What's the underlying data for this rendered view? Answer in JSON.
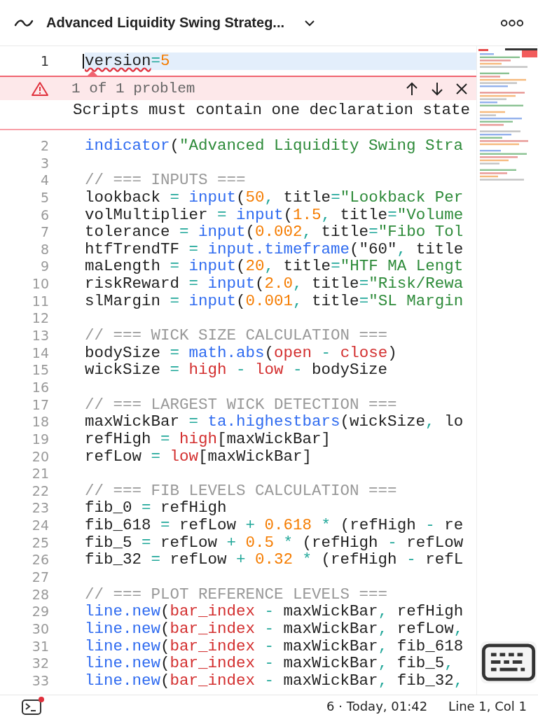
{
  "header": {
    "title": "Advanced Liquidity Swing Strateg..."
  },
  "lines": [
    {
      "number": "1",
      "current": true,
      "tokens": [
        {
          "text": "version",
          "kind": "plain",
          "error": true
        },
        {
          "text": "=",
          "kind": "op",
          "error": false
        },
        {
          "text": "5",
          "kind": "num",
          "error": false
        }
      ]
    },
    {
      "number": "2",
      "current": false,
      "tokens": [
        {
          "text": "indicator",
          "kind": "kw",
          "error": false
        },
        {
          "text": "(",
          "kind": "plain",
          "error": false
        },
        {
          "text": "\"Advanced Liquidity Swing Stra",
          "kind": "str",
          "error": false
        }
      ]
    },
    {
      "number": "3",
      "current": false
    },
    {
      "number": "4",
      "current": false,
      "tokens": [
        {
          "text": "// === INPUTS ===",
          "kind": "comment",
          "error": false
        }
      ]
    },
    {
      "number": "5",
      "current": false,
      "tokens": [
        {
          "text": "lookback ",
          "kind": "plain",
          "error": false
        },
        {
          "text": "= ",
          "kind": "op",
          "error": false
        },
        {
          "text": "input",
          "kind": "kw",
          "error": false
        },
        {
          "text": "(",
          "kind": "plain",
          "error": false
        },
        {
          "text": "50",
          "kind": "num",
          "error": false
        },
        {
          "text": ",",
          "kind": "op",
          "error": false
        },
        {
          "text": " title",
          "kind": "plain",
          "error": false
        },
        {
          "text": "=",
          "kind": "op",
          "error": false
        },
        {
          "text": "\"Lookback Per",
          "kind": "str",
          "error": false
        }
      ]
    },
    {
      "number": "6",
      "current": false,
      "tokens": [
        {
          "text": "volMultiplier ",
          "kind": "plain",
          "error": false
        },
        {
          "text": "= ",
          "kind": "op",
          "error": false
        },
        {
          "text": "input",
          "kind": "kw",
          "error": false
        },
        {
          "text": "(",
          "kind": "plain",
          "error": false
        },
        {
          "text": "1.5",
          "kind": "num",
          "error": false
        },
        {
          "text": ",",
          "kind": "op",
          "error": false
        },
        {
          "text": " title",
          "kind": "plain",
          "error": false
        },
        {
          "text": "=",
          "kind": "op",
          "error": false
        },
        {
          "text": "\"Volume",
          "kind": "str",
          "error": false
        }
      ]
    },
    {
      "number": "7",
      "current": false,
      "tokens": [
        {
          "text": "tolerance ",
          "kind": "plain",
          "error": false
        },
        {
          "text": "= ",
          "kind": "op",
          "error": false
        },
        {
          "text": "input",
          "kind": "kw",
          "error": false
        },
        {
          "text": "(",
          "kind": "plain",
          "error": false
        },
        {
          "text": "0.002",
          "kind": "num",
          "error": false
        },
        {
          "text": ",",
          "kind": "op",
          "error": false
        },
        {
          "text": " title",
          "kind": "plain",
          "error": false
        },
        {
          "text": "=",
          "kind": "op",
          "error": false
        },
        {
          "text": "\"Fibo Tol",
          "kind": "str",
          "error": false
        }
      ]
    },
    {
      "number": "8",
      "current": false,
      "tokens": [
        {
          "text": "htfTrendTF ",
          "kind": "plain",
          "error": false
        },
        {
          "text": "= ",
          "kind": "op",
          "error": false
        },
        {
          "text": "input.timeframe",
          "kind": "kw",
          "error": false
        },
        {
          "text": "(\"60\"",
          "kind": "plain",
          "error": false
        },
        {
          "text": ",",
          "kind": "op",
          "error": false
        },
        {
          "text": " title",
          "kind": "plain",
          "error": false
        }
      ]
    },
    {
      "number": "9",
      "current": false,
      "tokens": [
        {
          "text": "maLength ",
          "kind": "plain",
          "error": false
        },
        {
          "text": "= ",
          "kind": "op",
          "error": false
        },
        {
          "text": "input",
          "kind": "kw",
          "error": false
        },
        {
          "text": "(",
          "kind": "plain",
          "error": false
        },
        {
          "text": "20",
          "kind": "num",
          "error": false
        },
        {
          "text": ",",
          "kind": "op",
          "error": false
        },
        {
          "text": " title",
          "kind": "plain",
          "error": false
        },
        {
          "text": "=",
          "kind": "op",
          "error": false
        },
        {
          "text": "\"HTF MA Lengt",
          "kind": "str",
          "error": false
        }
      ]
    },
    {
      "number": "10",
      "current": false,
      "tokens": [
        {
          "text": "riskReward ",
          "kind": "plain",
          "error": false
        },
        {
          "text": "= ",
          "kind": "op",
          "error": false
        },
        {
          "text": "input",
          "kind": "kw",
          "error": false
        },
        {
          "text": "(",
          "kind": "plain",
          "error": false
        },
        {
          "text": "2.0",
          "kind": "num",
          "error": false
        },
        {
          "text": ",",
          "kind": "op",
          "error": false
        },
        {
          "text": " title",
          "kind": "plain",
          "error": false
        },
        {
          "text": "=",
          "kind": "op",
          "error": false
        },
        {
          "text": "\"Risk/Rewa",
          "kind": "str",
          "error": false
        }
      ]
    },
    {
      "number": "11",
      "current": false,
      "tokens": [
        {
          "text": "slMargin ",
          "kind": "plain",
          "error": false
        },
        {
          "text": "= ",
          "kind": "op",
          "error": false
        },
        {
          "text": "input",
          "kind": "kw",
          "error": false
        },
        {
          "text": "(",
          "kind": "plain",
          "error": false
        },
        {
          "text": "0.001",
          "kind": "num",
          "error": false
        },
        {
          "text": ",",
          "kind": "op",
          "error": false
        },
        {
          "text": " title",
          "kind": "plain",
          "error": false
        },
        {
          "text": "=",
          "kind": "op",
          "error": false
        },
        {
          "text": "\"SL Margin",
          "kind": "str",
          "error": false
        }
      ]
    },
    {
      "number": "12",
      "current": false
    },
    {
      "number": "13",
      "current": false,
      "tokens": [
        {
          "text": "// === WICK SIZE CALCULATION ===",
          "kind": "comment",
          "error": false
        }
      ]
    },
    {
      "number": "14",
      "current": false,
      "tokens": [
        {
          "text": "bodySize ",
          "kind": "plain",
          "error": false
        },
        {
          "text": "= ",
          "kind": "op",
          "error": false
        },
        {
          "text": "math.abs",
          "kind": "kw",
          "error": false
        },
        {
          "text": "(",
          "kind": "plain",
          "error": false
        },
        {
          "text": "open",
          "kind": "var",
          "error": false
        },
        {
          "text": " - ",
          "kind": "op",
          "error": false
        },
        {
          "text": "close",
          "kind": "var",
          "error": false
        },
        {
          "text": ")",
          "kind": "plain",
          "error": false
        }
      ]
    },
    {
      "number": "15",
      "current": false,
      "tokens": [
        {
          "text": "wickSize ",
          "kind": "plain",
          "error": false
        },
        {
          "text": "= ",
          "kind": "op",
          "error": false
        },
        {
          "text": "high",
          "kind": "var",
          "error": false
        },
        {
          "text": " - ",
          "kind": "op",
          "error": false
        },
        {
          "text": "low",
          "kind": "var",
          "error": false
        },
        {
          "text": " - ",
          "kind": "op",
          "error": false
        },
        {
          "text": "bodySize",
          "kind": "plain",
          "error": false
        }
      ]
    },
    {
      "number": "16",
      "current": false
    },
    {
      "number": "17",
      "current": false,
      "tokens": [
        {
          "text": "// === LARGEST WICK DETECTION ===",
          "kind": "comment",
          "error": false
        }
      ]
    },
    {
      "number": "18",
      "current": false,
      "tokens": [
        {
          "text": "maxWickBar ",
          "kind": "plain",
          "error": false
        },
        {
          "text": "= ",
          "kind": "op",
          "error": false
        },
        {
          "text": "ta.highestbars",
          "kind": "kw",
          "error": false
        },
        {
          "text": "(wickSize",
          "kind": "plain",
          "error": false
        },
        {
          "text": ",",
          "kind": "op",
          "error": false
        },
        {
          "text": " lo",
          "kind": "plain",
          "error": false
        }
      ]
    },
    {
      "number": "19",
      "current": false,
      "tokens": [
        {
          "text": "refHigh ",
          "kind": "plain",
          "error": false
        },
        {
          "text": "= ",
          "kind": "op",
          "error": false
        },
        {
          "text": "high",
          "kind": "var",
          "error": false
        },
        {
          "text": "[maxWickBar]",
          "kind": "plain",
          "error": false
        }
      ]
    },
    {
      "number": "20",
      "current": false,
      "tokens": [
        {
          "text": "refLow ",
          "kind": "plain",
          "error": false
        },
        {
          "text": "= ",
          "kind": "op",
          "error": false
        },
        {
          "text": "low",
          "kind": "var",
          "error": false
        },
        {
          "text": "[maxWickBar]",
          "kind": "plain",
          "error": false
        }
      ]
    },
    {
      "number": "21",
      "current": false
    },
    {
      "number": "22",
      "current": false,
      "tokens": [
        {
          "text": "// === FIB LEVELS CALCULATION ===",
          "kind": "comment",
          "error": false
        }
      ]
    },
    {
      "number": "23",
      "current": false,
      "tokens": [
        {
          "text": "fib_0 ",
          "kind": "plain",
          "error": false
        },
        {
          "text": "=",
          "kind": "op",
          "error": false
        },
        {
          "text": " refHigh",
          "kind": "plain",
          "error": false
        }
      ]
    },
    {
      "number": "24",
      "current": false,
      "tokens": [
        {
          "text": "fib_618 ",
          "kind": "plain",
          "error": false
        },
        {
          "text": "=",
          "kind": "op",
          "error": false
        },
        {
          "text": " refLow ",
          "kind": "plain",
          "error": false
        },
        {
          "text": "+ ",
          "kind": "op",
          "error": false
        },
        {
          "text": "0.618",
          "kind": "num",
          "error": false
        },
        {
          "text": " * ",
          "kind": "op",
          "error": false
        },
        {
          "text": "(refHigh ",
          "kind": "plain",
          "error": false
        },
        {
          "text": "-",
          "kind": "op",
          "error": false
        },
        {
          "text": " re",
          "kind": "plain",
          "error": false
        }
      ]
    },
    {
      "number": "25",
      "current": false,
      "tokens": [
        {
          "text": "fib_5 ",
          "kind": "plain",
          "error": false
        },
        {
          "text": "=",
          "kind": "op",
          "error": false
        },
        {
          "text": " refLow ",
          "kind": "plain",
          "error": false
        },
        {
          "text": "+ ",
          "kind": "op",
          "error": false
        },
        {
          "text": "0.5",
          "kind": "num",
          "error": false
        },
        {
          "text": " * ",
          "kind": "op",
          "error": false
        },
        {
          "text": "(refHigh ",
          "kind": "plain",
          "error": false
        },
        {
          "text": "-",
          "kind": "op",
          "error": false
        },
        {
          "text": " refLow",
          "kind": "plain",
          "error": false
        }
      ]
    },
    {
      "number": "26",
      "current": false,
      "tokens": [
        {
          "text": "fib_32 ",
          "kind": "plain",
          "error": false
        },
        {
          "text": "=",
          "kind": "op",
          "error": false
        },
        {
          "text": " refLow ",
          "kind": "plain",
          "error": false
        },
        {
          "text": "+ ",
          "kind": "op",
          "error": false
        },
        {
          "text": "0.32",
          "kind": "num",
          "error": false
        },
        {
          "text": " * ",
          "kind": "op",
          "error": false
        },
        {
          "text": "(refHigh ",
          "kind": "plain",
          "error": false
        },
        {
          "text": "-",
          "kind": "op",
          "error": false
        },
        {
          "text": " refL",
          "kind": "plain",
          "error": false
        }
      ]
    },
    {
      "number": "27",
      "current": false
    },
    {
      "number": "28",
      "current": false,
      "tokens": [
        {
          "text": "// === PLOT REFERENCE LEVELS ===",
          "kind": "comment",
          "error": false
        }
      ]
    },
    {
      "number": "29",
      "current": false,
      "tokens": [
        {
          "text": "line.new",
          "kind": "kw",
          "error": false
        },
        {
          "text": "(",
          "kind": "plain",
          "error": false
        },
        {
          "text": "bar_index",
          "kind": "var",
          "error": false
        },
        {
          "text": " - ",
          "kind": "op",
          "error": false
        },
        {
          "text": "maxWickBar",
          "kind": "plain",
          "error": false
        },
        {
          "text": ",",
          "kind": "op",
          "error": false
        },
        {
          "text": " refHigh",
          "kind": "plain",
          "error": false
        }
      ]
    },
    {
      "number": "30",
      "current": false,
      "tokens": [
        {
          "text": "line.new",
          "kind": "kw",
          "error": false
        },
        {
          "text": "(",
          "kind": "plain",
          "error": false
        },
        {
          "text": "bar_index",
          "kind": "var",
          "error": false
        },
        {
          "text": " - ",
          "kind": "op",
          "error": false
        },
        {
          "text": "maxWickBar",
          "kind": "plain",
          "error": false
        },
        {
          "text": ",",
          "kind": "op",
          "error": false
        },
        {
          "text": " refLow",
          "kind": "plain",
          "error": false
        },
        {
          "text": ",",
          "kind": "op",
          "error": false
        }
      ]
    },
    {
      "number": "31",
      "current": false,
      "tokens": [
        {
          "text": "line.new",
          "kind": "kw",
          "error": false
        },
        {
          "text": "(",
          "kind": "plain",
          "error": false
        },
        {
          "text": "bar_index",
          "kind": "var",
          "error": false
        },
        {
          "text": " - ",
          "kind": "op",
          "error": false
        },
        {
          "text": "maxWickBar",
          "kind": "plain",
          "error": false
        },
        {
          "text": ",",
          "kind": "op",
          "error": false
        },
        {
          "text": " fib_618",
          "kind": "plain",
          "error": false
        }
      ]
    },
    {
      "number": "32",
      "current": false,
      "tokens": [
        {
          "text": "line.new",
          "kind": "kw",
          "error": false
        },
        {
          "text": "(",
          "kind": "plain",
          "error": false
        },
        {
          "text": "bar_index",
          "kind": "var",
          "error": false
        },
        {
          "text": " - ",
          "kind": "op",
          "error": false
        },
        {
          "text": "maxWickBar",
          "kind": "plain",
          "error": false
        },
        {
          "text": ",",
          "kind": "op",
          "error": false
        },
        {
          "text": " fib_5",
          "kind": "plain",
          "error": false
        },
        {
          "text": ",",
          "kind": "op",
          "error": false
        }
      ]
    },
    {
      "number": "33",
      "current": false,
      "tokens": [
        {
          "text": "line.new",
          "kind": "kw",
          "error": false
        },
        {
          "text": "(",
          "kind": "plain",
          "error": false
        },
        {
          "text": "bar_index",
          "kind": "var",
          "error": false
        },
        {
          "text": " - ",
          "kind": "op",
          "error": false
        },
        {
          "text": "maxWickBar",
          "kind": "plain",
          "error": false
        },
        {
          "text": ",",
          "kind": "op",
          "error": false
        },
        {
          "text": " fib_32",
          "kind": "plain",
          "error": false
        },
        {
          "text": ",",
          "kind": "op",
          "error": false
        }
      ]
    }
  ],
  "problem": {
    "counter": "1 of 1 problem",
    "message": "Scripts must contain one declaration state"
  },
  "status_bar": {
    "notification": true,
    "saved": "6 · Today, 01:42",
    "position": "Line 1, Col 1"
  }
}
